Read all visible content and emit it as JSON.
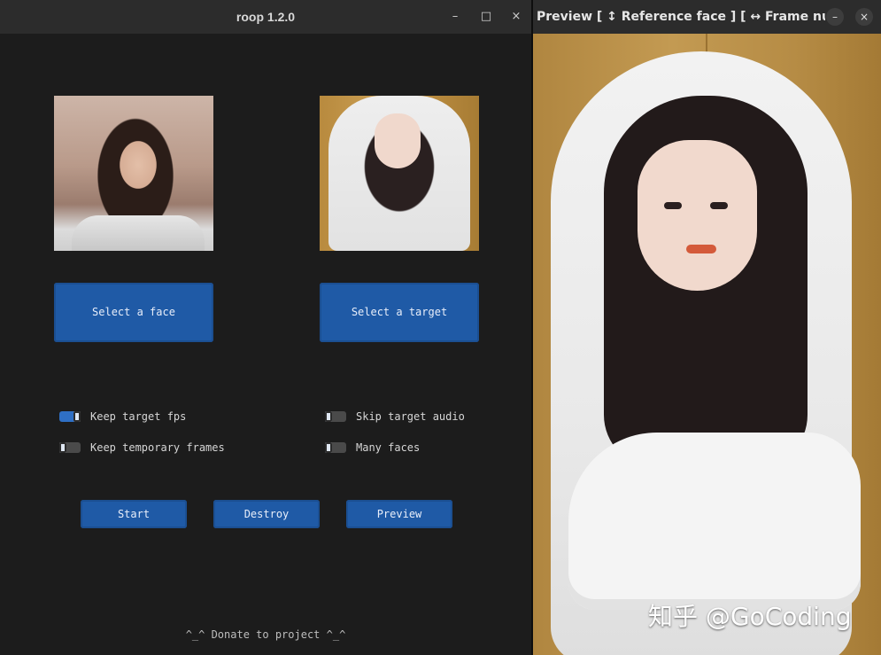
{
  "left_window": {
    "title": "roop 1.2.0",
    "controls": {
      "minimize": "–",
      "maximize": "□",
      "close": "×"
    },
    "select_face_label": "Select a face",
    "select_target_label": "Select a target",
    "switches": [
      {
        "label": "Keep target fps",
        "on": true
      },
      {
        "label": "Skip target audio",
        "on": false
      },
      {
        "label": "Keep temporary frames",
        "on": false
      },
      {
        "label": "Many faces",
        "on": false
      }
    ],
    "buttons": {
      "start": "Start",
      "destroy": "Destroy",
      "preview": "Preview"
    },
    "donate": "^_^ Donate to project ^_^",
    "colors": {
      "accent": "#1f5aa6",
      "bg": "#1c1c1c",
      "titlebar": "#2c2c2c"
    }
  },
  "preview_window": {
    "title": "Preview [ ↕ Reference face ] [ ↔ Frame num...",
    "controls": {
      "minimize": "–",
      "close": "×"
    },
    "watermark": "知乎 @GoCoding"
  }
}
